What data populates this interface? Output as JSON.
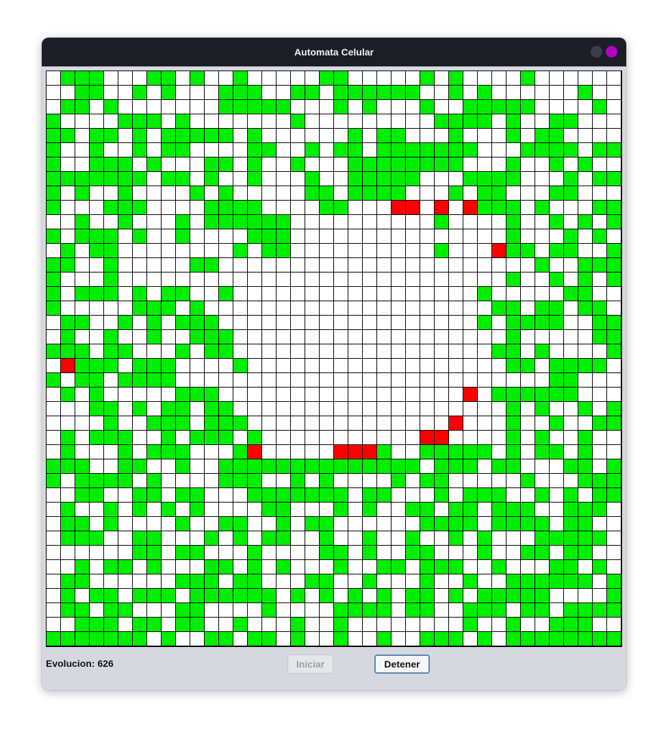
{
  "window": {
    "title": "Automata Celular",
    "controls": [
      "minimize-button",
      "close-button"
    ],
    "close_color": "#b000c4"
  },
  "grid": {
    "rows": 40,
    "cols": 40,
    "colors": {
      "live": "#00ee00",
      "dead": "#ffffff",
      "marked": "#ff0000",
      "border": "#000000"
    },
    "cells": [
      "01110001101001000001100000101000010000000",
      "00110010100011100110111111001010000001001",
      "01101000000011111000101000100111110000101",
      "10000111010000000100000000011110100110000",
      "11011010111110100000010110001000101100000",
      "10010010110000110010110111111100011110110",
      "10011101000110100100011111111000100101000",
      "11111110110100100010011111000111100010110",
      "10100100001010000011011110001011000110000",
      "10001110000111100001100022020211101000111",
      "00100100010111111000000000010000100101010",
      "10111010010000111000000000000000100010100",
      "01011000000001011000000000010002110110011",
      "11001000001100000000000000000000001001110",
      "10001000000000000000000000000000100101010",
      "10111010110010000000000000000010000011001",
      "10000011101000000000000000000001101101100",
      "01100101011100000000000000000010111100111",
      "01001001001110000000000000000000100000111",
      "11101100010110000000000000000001101000011",
      "02111011100001000000000000000000110111101",
      "10110111100000000000000000000000000110001",
      "01010000011100000000000000000201111110000",
      "00011010110110000000000000000000101001010",
      "00001001110111000000000000002000100100111",
      "01011100101110100000000000220000101001000",
      "01000101110001200000222100111110101101001",
      "11100110010011111111111111011101100011010",
      "10111101000011100101000010110000010001111",
      "00110011011000111111101100010111001010111",
      "01001010101000011000101001101101110011101",
      "01101000010011001011000000111101111011000",
      "01110011000101011001001001001010001111101",
      "00000011011000100001101001100010011011000",
      "00101101000110101000100110111001000110100",
      "01100000011101100011001000100100111111010",
      "01011011101111110101010101101011111000010",
      "01101100011000010000111101100111011011110",
      "00111011011001000100100000000100100111000",
      "11111110100110110100100100111010111111111"
    ]
  },
  "footer": {
    "status_label": "Evolucion: 626",
    "start_button": "Iniciar",
    "stop_button": "Detener"
  }
}
